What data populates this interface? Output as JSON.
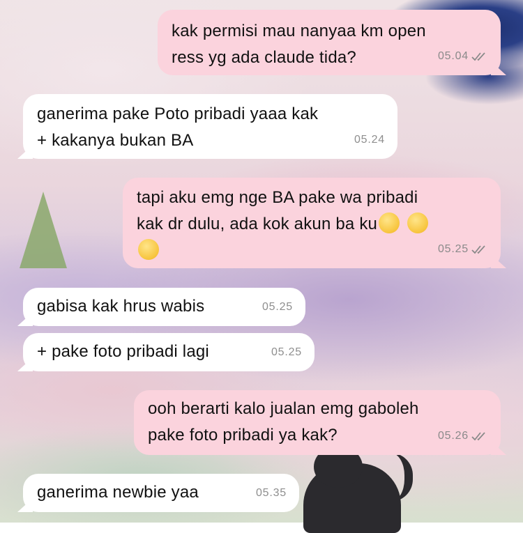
{
  "messages": [
    {
      "direction": "out",
      "text": "kak permisi mau nanyaa km open\nress yg ada claude tida?",
      "time": "05.04",
      "read": true
    },
    {
      "direction": "in",
      "text": "ganerima pake Poto pribadi yaaa kak\n+ kakanya bukan BA",
      "time": "05.24"
    },
    {
      "direction": "out",
      "text": "tapi aku emg nge BA pake wa pribadi\nkak dr dulu, ada kok akun ba ku",
      "emojis": [
        "crying-face",
        "crying-face",
        "halo-face"
      ],
      "time": "05.25",
      "read": true
    },
    {
      "direction": "in",
      "text": "gabisa kak hrus wabis",
      "time": "05.25"
    },
    {
      "direction": "in",
      "text": "+ pake foto pribadi lagi",
      "time": "05.25"
    },
    {
      "direction": "out",
      "text": "ooh berarti kalo jualan emg gaboleh\npake foto pribadi ya kak?",
      "time": "05.26",
      "read": true
    },
    {
      "direction": "in",
      "text": "ganerima newbie yaa",
      "time": "05.35"
    }
  ],
  "colors": {
    "outgoing_bubble": "#fbd3dd",
    "incoming_bubble": "#ffffff",
    "time": "#8a8a8a"
  }
}
